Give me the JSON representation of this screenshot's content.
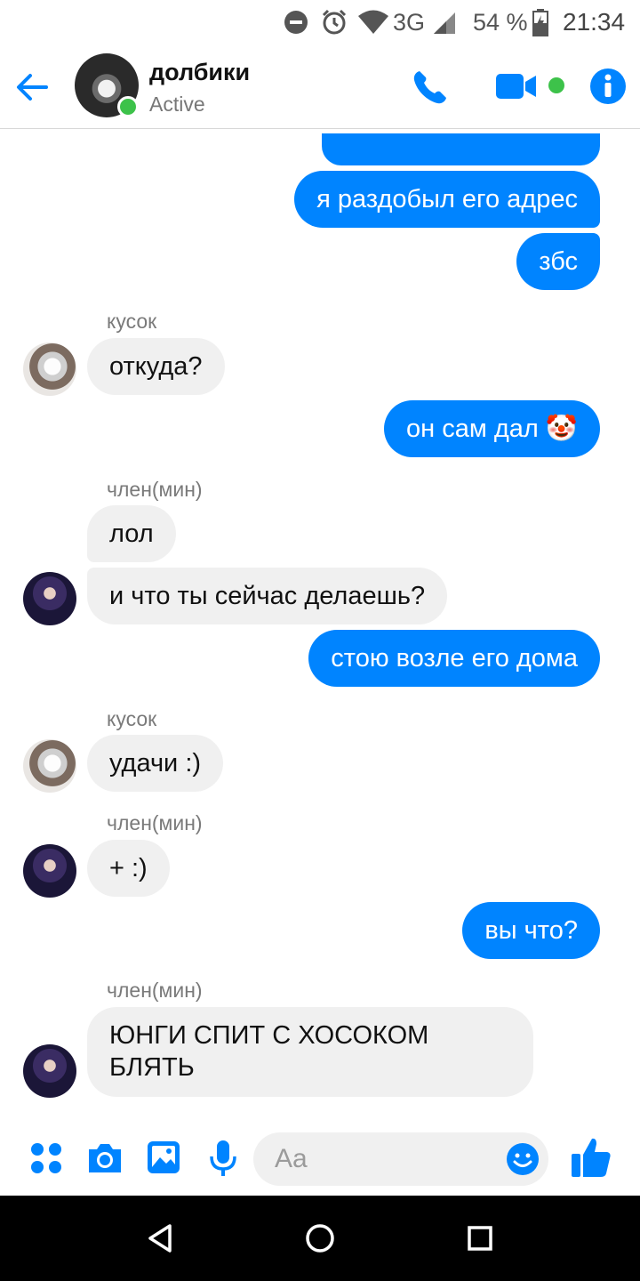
{
  "status_bar": {
    "network": "3G",
    "battery_percent": "54 %",
    "time": "21:34",
    "icons": [
      "do-not-disturb-icon",
      "alarm-icon",
      "wifi-icon",
      "signal-icon",
      "battery-icon"
    ]
  },
  "header": {
    "title": "долбики",
    "status": "Active",
    "icons": [
      "back-arrow-icon",
      "phone-icon",
      "video-icon",
      "info-icon"
    ]
  },
  "messages": [
    {
      "direction": "out",
      "text": ""
    },
    {
      "direction": "out",
      "text": "я раздобыл его адрес"
    },
    {
      "direction": "out",
      "text": "збс"
    },
    {
      "direction": "in",
      "sender": "кусок",
      "text": "откуда?"
    },
    {
      "direction": "out",
      "text": "он сам дал 🤡"
    },
    {
      "direction": "in",
      "sender": "член(мин)",
      "text": "лол"
    },
    {
      "direction": "in",
      "text": "и что ты сейчас делаешь?"
    },
    {
      "direction": "out",
      "text": "стою возле его дома"
    },
    {
      "direction": "in",
      "sender": "кусок",
      "text": "удачи :)"
    },
    {
      "direction": "in",
      "sender": "член(мин)",
      "text": "+ :)"
    },
    {
      "direction": "out",
      "text": "вы что?"
    },
    {
      "direction": "in",
      "sender": "член(мин)",
      "text_line1": "ЮНГИ СПИТ С ХОСОКОМ",
      "text_line2": "БЛЯТЬ"
    }
  ],
  "composer": {
    "placeholder": "Aa",
    "icons": [
      "apps-icon",
      "camera-icon",
      "image-icon",
      "microphone-icon",
      "emoji-icon",
      "thumbs-up-icon"
    ]
  },
  "navigation": {
    "icons": [
      "back-icon",
      "home-icon",
      "recents-icon"
    ]
  },
  "colors": {
    "accent": "#0084ff",
    "online": "#3dc24a",
    "incoming_bubble": "#f0f0f0"
  }
}
